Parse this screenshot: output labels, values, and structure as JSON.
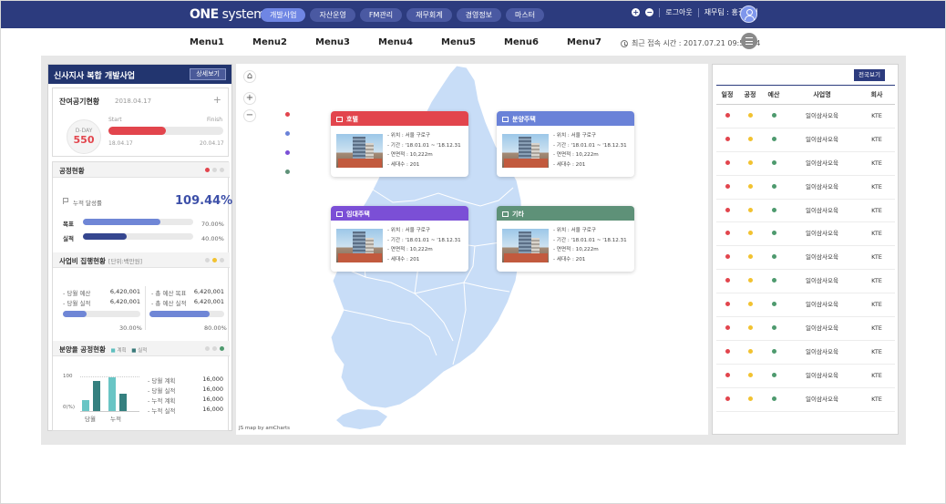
{
  "header": {
    "logo_bold": "ONE",
    "logo_light": " system",
    "nav": [
      "개발사업",
      "자산운영",
      "FM관리",
      "재무회계",
      "경영정보",
      "마스터"
    ],
    "nav_active": 0,
    "logout": "로그아웃",
    "user_greeting": "재무팀 : 홍길동님"
  },
  "menubar": {
    "items": [
      "Menu1",
      "Menu2",
      "Menu3",
      "Menu4",
      "Menu5",
      "Menu6",
      "Menu7"
    ],
    "last_login": "최근 접속 시간 : 2017.07.21 09:56:44"
  },
  "left": {
    "title": "신사지사 복합 개발사업",
    "detail_button": "상세보기",
    "remaining": {
      "title": "잔여공기현황",
      "date": "2018.04.17",
      "dday_label": "D-DAY",
      "dday_value": "550",
      "start_label": "Start",
      "finish_label": "Finish",
      "start_date": "18.04.17",
      "finish_date": "20.04.17",
      "progress": 0.5
    },
    "progress_section": {
      "title": "공정현황",
      "cumulative_label": "누적 달성률",
      "cumulative_value": "109.44%",
      "target_label": "목표",
      "target_pct": "70.00%",
      "target_value": 0.7,
      "actual_label": "실적",
      "actual_pct": "40.00%",
      "actual_value": 0.4
    },
    "budget": {
      "title": "사업비 집행현황",
      "unit": "[단위:백만원]",
      "plan_label": "- 당월 예산",
      "plan_value": "6,420,001",
      "actual_label": "- 당월 실적",
      "actual_value": "6,420,001",
      "total_plan_label": "- 총 예산 목표",
      "total_plan_value": "6,420,001",
      "total_actual_label": "- 총 예산 실적",
      "total_actual_value": "6,420,001",
      "left_pct": "30.00%",
      "left_value": 0.3,
      "right_pct": "80.00%",
      "right_value": 0.8
    },
    "sales": {
      "title": "분양율 공정현황",
      "legend_plan": "계획",
      "legend_actual": "실적",
      "y_max": "100",
      "y_min": "0(%)",
      "x_labels": [
        "당월",
        "누적"
      ],
      "items": [
        {
          "label": "- 당월 계획",
          "value": "16,000"
        },
        {
          "label": "- 당월 실적",
          "value": "16,000"
        },
        {
          "label": "- 누적 계획",
          "value": "16,000"
        },
        {
          "label": "- 누적 실적",
          "value": "16,000"
        }
      ]
    }
  },
  "map": {
    "credit": "JS map by amCharts",
    "popups": [
      {
        "title": "호텔",
        "color": "#e2454d",
        "lines": [
          "- 위치 : 서울 구로구",
          "- 기간 : '18.01.01 ~ '18.12.31",
          "- 연면적 : 10,222m",
          "- 세대수 : 201"
        ]
      },
      {
        "title": "분양주택",
        "color": "#6a82d8",
        "lines": [
          "- 위치 : 서울 구로구",
          "- 기간 : '18.01.01 ~ '18.12.31",
          "- 연면적 : 10,222m",
          "- 세대수 : 201"
        ]
      },
      {
        "title": "임대주택",
        "color": "#7b4fd6",
        "lines": [
          "- 위치 : 서울 구로구",
          "- 기간 : '18.01.01 ~ '18.12.31",
          "- 연면적 : 10,222m",
          "- 세대수 : 201"
        ]
      },
      {
        "title": "기타",
        "color": "#5e9178",
        "lines": [
          "- 위치 : 서울 구로구",
          "- 기간 : '18.01.01 ~ '18.12.31",
          "- 연면적 : 10,222m",
          "- 세대수 : 201"
        ]
      }
    ]
  },
  "right": {
    "all_button": "전국보기",
    "columns": [
      "일정",
      "공정",
      "예산",
      "사업명",
      "회사"
    ],
    "rows": [
      {
        "name": "일이삼사오육",
        "company": "KTE"
      },
      {
        "name": "일이삼사오육",
        "company": "KTE"
      },
      {
        "name": "일이삼사오육",
        "company": "KTE"
      },
      {
        "name": "일이삼사오육",
        "company": "KTE"
      },
      {
        "name": "일이삼사오육",
        "company": "KTE"
      },
      {
        "name": "일이삼사오육",
        "company": "KTE"
      },
      {
        "name": "일이삼사오육",
        "company": "KTE"
      },
      {
        "name": "일이삼사오육",
        "company": "KTE"
      },
      {
        "name": "일이삼사오육",
        "company": "KTE"
      },
      {
        "name": "일이삼사오육",
        "company": "KTE"
      },
      {
        "name": "일이삼사오육",
        "company": "KTE"
      },
      {
        "name": "일이삼사오육",
        "company": "KTE"
      },
      {
        "name": "일이삼사오육",
        "company": "KTE"
      }
    ],
    "status_colors": {
      "schedule": "#e2454d",
      "process": "#f2c230",
      "budget": "#4e9a6e"
    }
  }
}
